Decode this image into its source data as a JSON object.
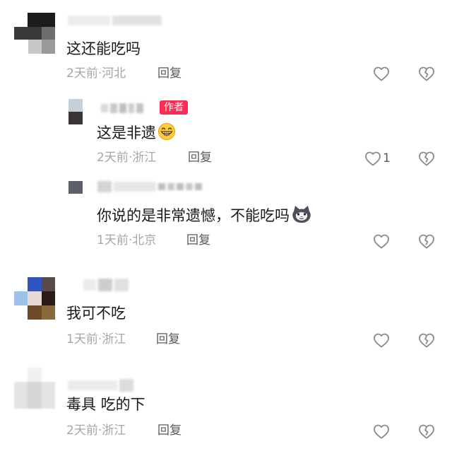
{
  "comments": [
    {
      "text": "这还能吃吗",
      "meta": "2天前·河北",
      "reply_label": "回复",
      "likes": ""
    },
    {
      "text": "这是非遗",
      "author_badge": "作者",
      "meta": "2天前·浙江",
      "reply_label": "回复",
      "likes": "1"
    },
    {
      "text": "你说的是非常遗憾，不能吃吗",
      "meta": "1天前·北京",
      "reply_label": "回复",
      "likes": ""
    },
    {
      "text": "我可不吃",
      "meta": "1天前·浙江",
      "reply_label": "回复",
      "likes": ""
    },
    {
      "text": "毒具 吃的下",
      "meta": "2天前·浙江",
      "reply_label": "回复",
      "likes": ""
    }
  ],
  "icons": {
    "like": "heart-outline-icon",
    "dislike": "broken-heart-icon",
    "grin_emoji": "grinning-face-emoji",
    "cat_emoji": "cat-face-emoji"
  },
  "colors": {
    "badge": "#fe2c55",
    "meta": "#a6a6a6",
    "icon": "#8a8a8a"
  }
}
